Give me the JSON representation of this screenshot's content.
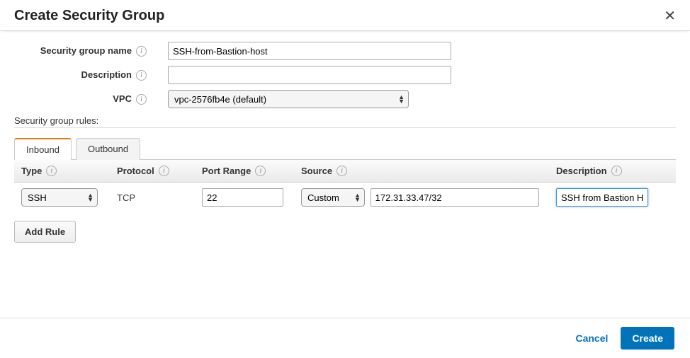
{
  "header": {
    "title": "Create Security Group"
  },
  "form": {
    "name_label": "Security group name",
    "name_value": "SSH-from-Bastion-host",
    "desc_label": "Description",
    "desc_value": "",
    "vpc_label": "VPC",
    "vpc_value": "vpc-2576fb4e (default)"
  },
  "rules": {
    "section_label": "Security group rules:",
    "tabs": [
      "Inbound",
      "Outbound"
    ],
    "columns": [
      "Type",
      "Protocol",
      "Port Range",
      "Source",
      "Description"
    ],
    "rows": [
      {
        "type": "SSH",
        "protocol": "TCP",
        "port": "22",
        "source_type": "Custom",
        "source_value": "172.31.33.47/32",
        "description": "SSH from Bastion Ho"
      }
    ],
    "add_rule_label": "Add Rule"
  },
  "footer": {
    "cancel_label": "Cancel",
    "create_label": "Create"
  }
}
